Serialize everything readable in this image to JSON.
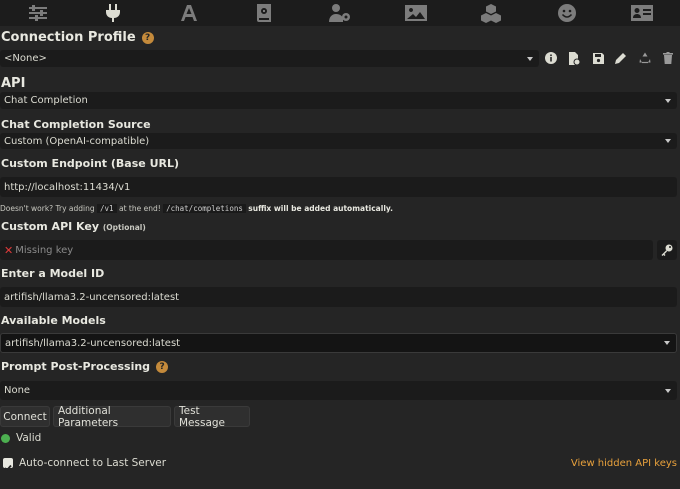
{
  "topnav": [
    {
      "name": "sliders-icon",
      "active": false
    },
    {
      "name": "plug-icon",
      "active": true
    },
    {
      "name": "font-icon",
      "active": false
    },
    {
      "name": "book-icon",
      "active": false
    },
    {
      "name": "user-gear-icon",
      "active": false
    },
    {
      "name": "image-icon",
      "active": false
    },
    {
      "name": "cubes-icon",
      "active": false
    },
    {
      "name": "smile-icon",
      "active": false
    },
    {
      "name": "id-card-icon",
      "active": false
    }
  ],
  "connection_profile": {
    "title": "Connection Profile",
    "help": "?",
    "selected": "<None>",
    "actions": [
      "info-icon",
      "file-import-icon",
      "save-icon",
      "pencil-icon",
      "recycle-icon",
      "trash-icon"
    ]
  },
  "api": {
    "title": "API",
    "selected": "Chat Completion"
  },
  "chat_completion_source": {
    "title": "Chat Completion Source",
    "selected": "Custom (OpenAI-compatible)"
  },
  "custom_endpoint": {
    "title": "Custom Endpoint (Base URL)",
    "value": "http://localhost:11434/v1",
    "hint_prefix": "Doesn't work? Try adding",
    "hint_code1": "/v1",
    "hint_middle": "at the end!",
    "hint_code2": "/chat/completions",
    "hint_suffix": "suffix will be added automatically."
  },
  "custom_api_key": {
    "title": "Custom API Key",
    "optional": "(Optional)",
    "placeholder": "Missing key",
    "missing_mark": "✕"
  },
  "model_id": {
    "title": "Enter a Model ID",
    "value": "artifish/llama3.2-uncensored:latest"
  },
  "available_models": {
    "title": "Available Models",
    "selected": "artifish/llama3.2-uncensored:latest"
  },
  "post_processing": {
    "title": "Prompt Post-Processing",
    "help": "?",
    "selected": "None"
  },
  "buttons": {
    "connect": "Connect",
    "additional": "Additional Parameters",
    "test": "Test Message"
  },
  "status": {
    "label": "Valid",
    "color": "#4caf50"
  },
  "auto_connect": {
    "label": "Auto-connect to Last Server",
    "checked": true
  },
  "view_hidden_keys": "View hidden API keys",
  "colors": {
    "accent_orange": "#e8a13c",
    "help_orange": "#c48a3b",
    "error_red": "#e03b3b"
  }
}
